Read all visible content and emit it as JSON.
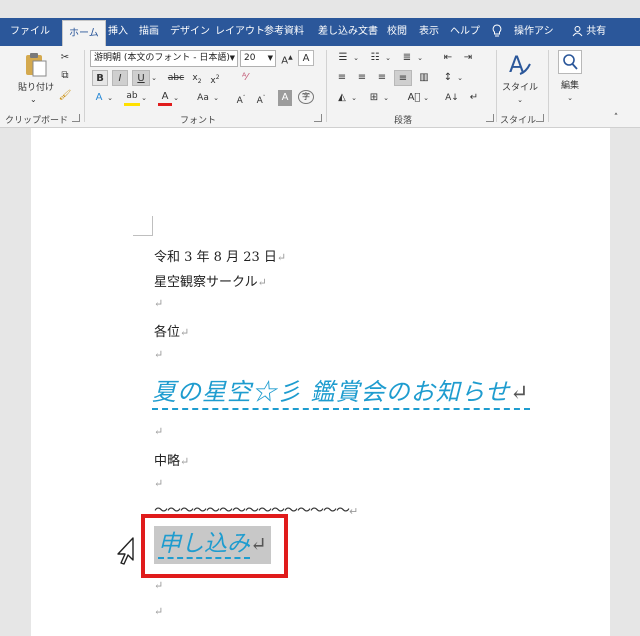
{
  "ribbon": {
    "tabs": [
      {
        "label": "ファイル",
        "active": false
      },
      {
        "label": "ホーム",
        "active": true
      },
      {
        "label": "挿入",
        "active": false
      },
      {
        "label": "描画",
        "active": false
      },
      {
        "label": "デザイン",
        "active": false
      },
      {
        "label": "レイアウト",
        "active": false
      },
      {
        "label": "参考資料",
        "active": false
      },
      {
        "label": "差し込み文書",
        "active": false
      },
      {
        "label": "校閲",
        "active": false
      },
      {
        "label": "表示",
        "active": false
      },
      {
        "label": "ヘルプ",
        "active": false
      }
    ],
    "tell_me": "操作アシ",
    "share": "共有",
    "clipboard": {
      "paste_label": "貼り付け",
      "group_label": "クリップボード"
    },
    "font": {
      "font_name": "游明朝 (本文のフォント - 日本語)",
      "font_size": "20",
      "group_label": "フォント"
    },
    "paragraph": {
      "group_label": "段落"
    },
    "styles": {
      "label": "スタイル",
      "group_label": "スタイル"
    },
    "editing": {
      "label": "編集"
    },
    "accent_color": "#2b579a"
  },
  "document": {
    "lines": {
      "date": "令和 3 年 8 月 23 日",
      "org": "星空観察サークル",
      "recipients": "各位",
      "title": "夏の星空☆彡 鑑賞会のお知らせ",
      "chuuryaku": "中略",
      "wave": "～～～～～～～～～～～～～～～",
      "heading2": "申し込み"
    },
    "paragraph_mark": "↵",
    "heading_color": "#1e9ccf",
    "highlight_color": "#e01b1b"
  }
}
